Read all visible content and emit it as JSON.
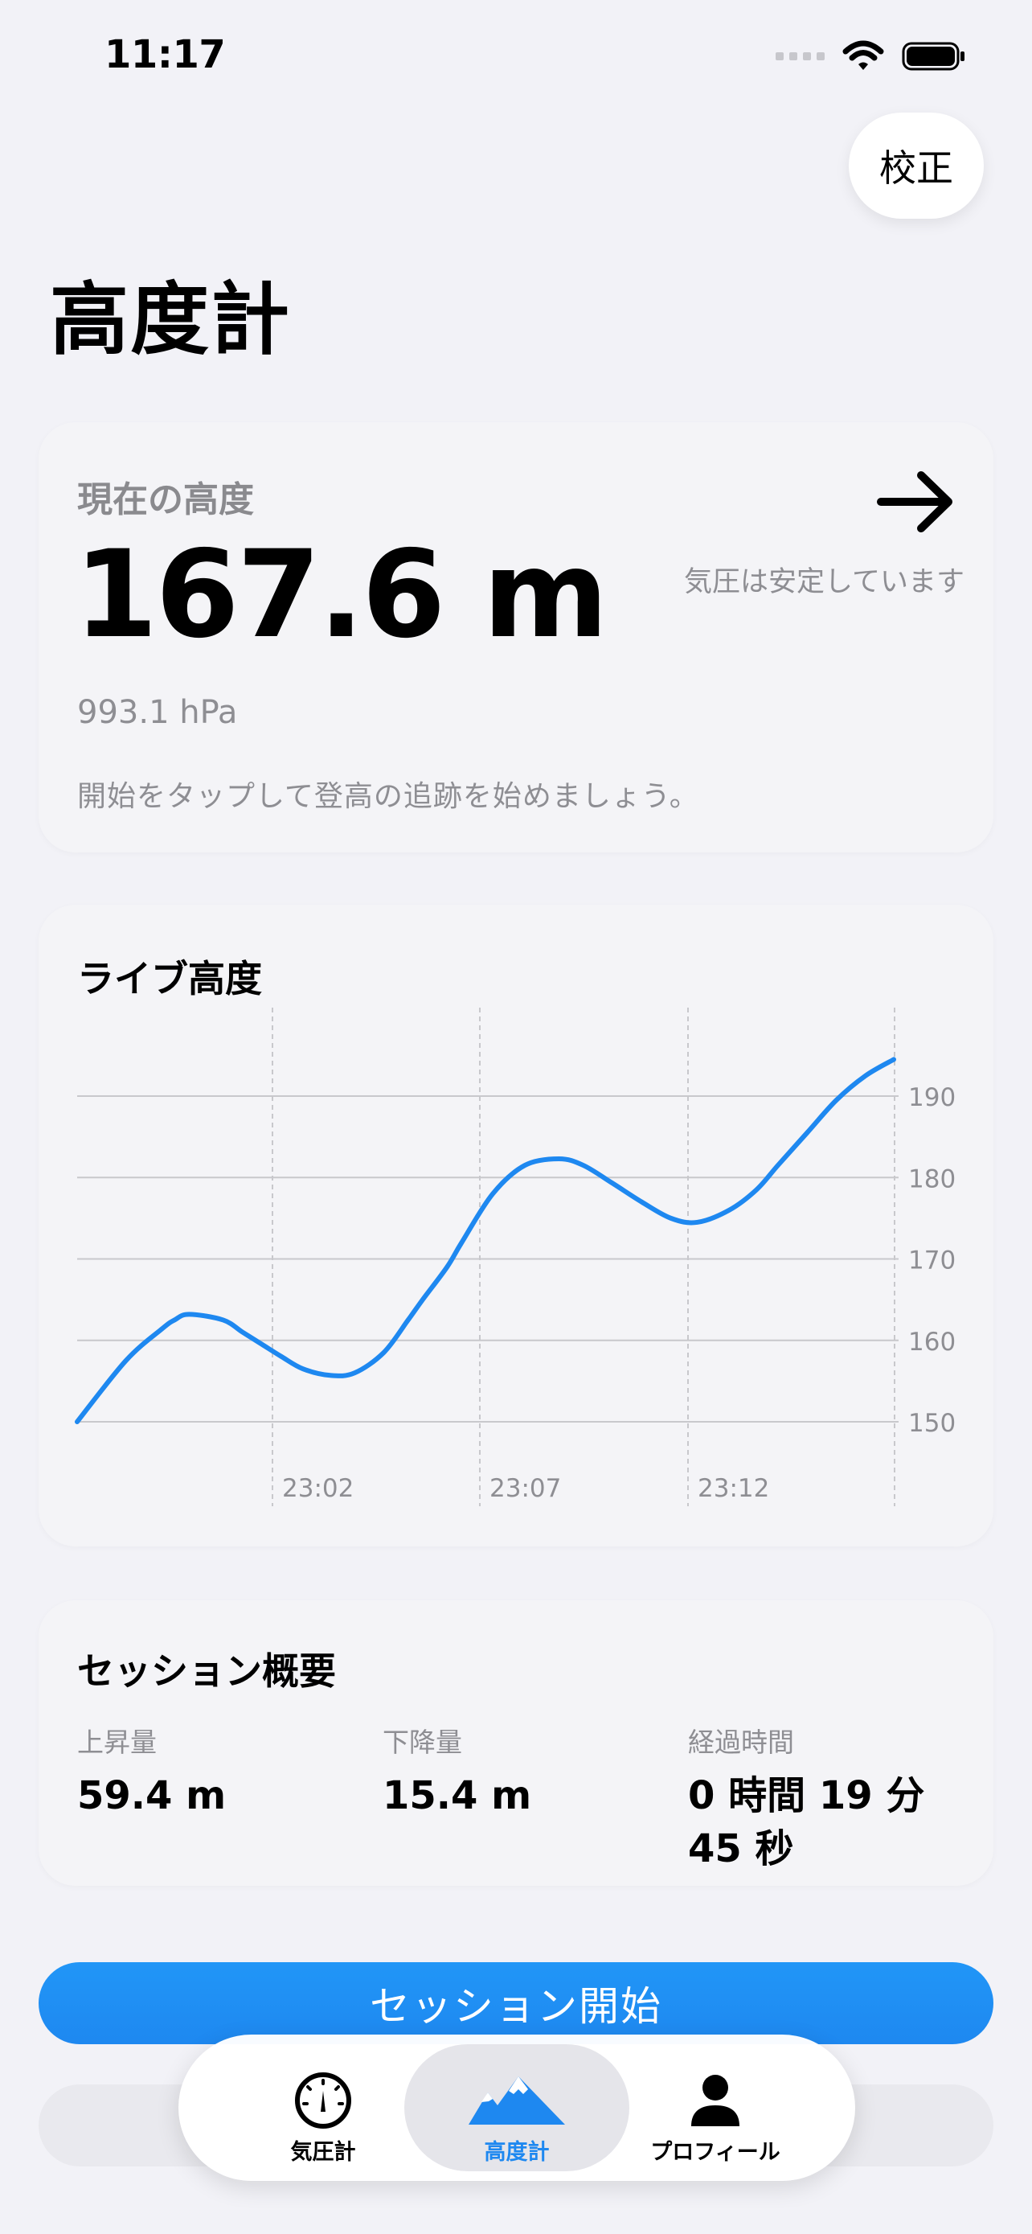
{
  "status_bar": {
    "time": "11:17"
  },
  "header": {
    "title": "高度計",
    "calibrate_label": "校正"
  },
  "current": {
    "label": "現在の高度",
    "altitude": "167.6 m",
    "pressure": "993.1 hPa",
    "hint": "開始をタップして登高の追跡を始めましょう。",
    "trend_icon": "arrow-right-icon",
    "trend_text": "気圧は安定しています"
  },
  "chart": {
    "title": "ライブ高度"
  },
  "chart_data": {
    "type": "line",
    "title": "ライブ高度",
    "x_tick_labels": [
      "23:02",
      "23:07",
      "23:12"
    ],
    "y_ticks": [
      150,
      160,
      170,
      180,
      190
    ],
    "ylim": [
      146,
      196
    ],
    "y_axis_side": "right",
    "grid": true,
    "color": "#1E88F0",
    "series": [
      {
        "x": [
          0,
          5,
          8.7,
          10,
          11.5,
          15,
          17,
          19,
          21,
          23.2,
          26,
          28.5,
          31.5,
          34,
          35.5,
          38,
          39.5,
          42.7,
          46,
          49.5,
          52,
          55,
          58,
          61,
          63.7,
          67,
          69.8,
          72,
          75,
          78,
          81,
          83.9
        ],
        "y": [
          150,
          157.5,
          161.4,
          162.5,
          163.2,
          162.5,
          161,
          159.5,
          158,
          156.5,
          155.7,
          156,
          158.5,
          162.5,
          165,
          169,
          172,
          178,
          181.5,
          182.3,
          181.5,
          179.3,
          177,
          175,
          174.5,
          176,
          178.5,
          181.5,
          185.5,
          189.5,
          192.5,
          194.5
        ]
      }
    ]
  },
  "summary": {
    "title": "セッション概要",
    "ascent_label": "上昇量",
    "ascent_value": "59.4 m",
    "descent_label": "下降量",
    "descent_value": "15.4 m",
    "elapsed_label": "経過時間",
    "elapsed_value": "0 時間 19 分 45 秒"
  },
  "start_button": {
    "label": "セッション開始"
  },
  "tabs": [
    {
      "label": "気圧計",
      "icon": "gauge-icon",
      "active": false
    },
    {
      "label": "高度計",
      "icon": "mountains-icon",
      "active": true
    },
    {
      "label": "プロフィール",
      "icon": "person-icon",
      "active": false
    }
  ],
  "colors": {
    "accent": "#1E88F0",
    "background": "#F2F2F7",
    "secondary_text": "#8E8E93"
  }
}
